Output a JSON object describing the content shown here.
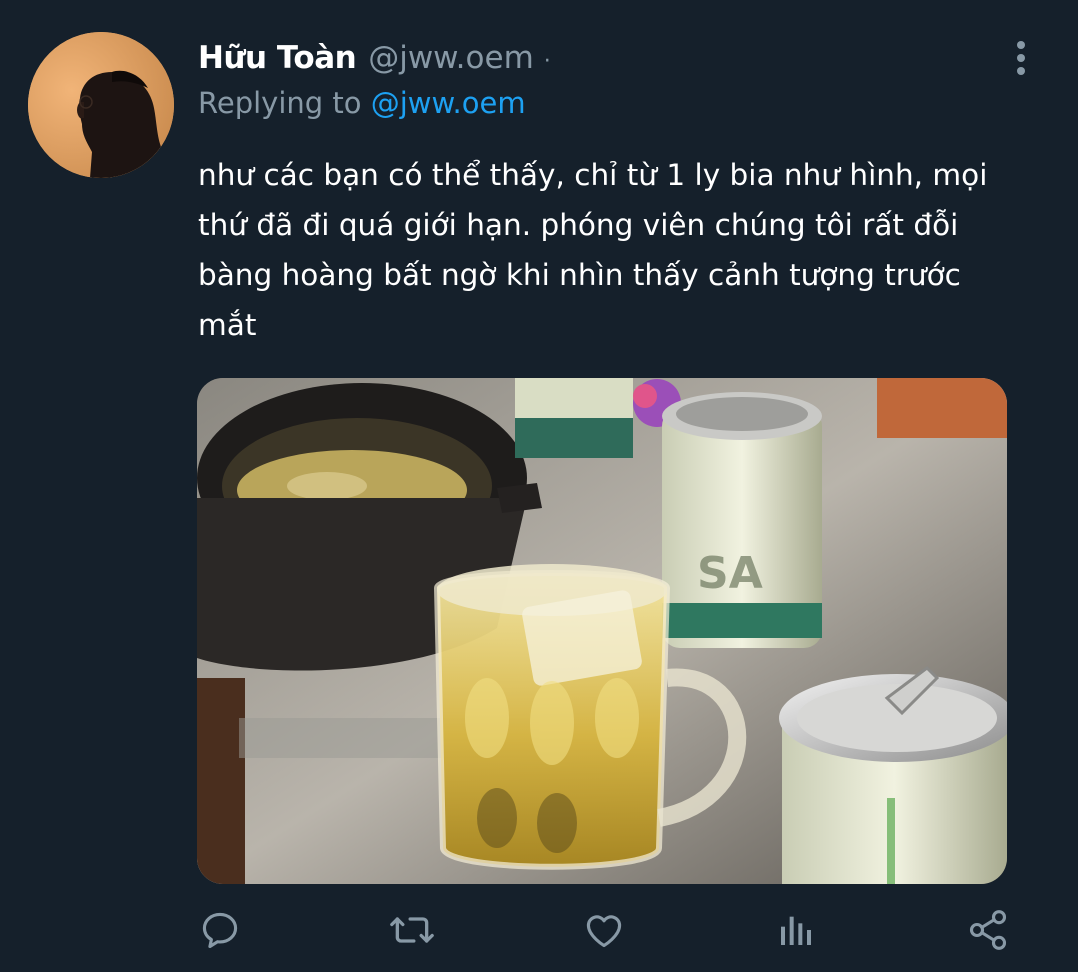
{
  "tweet": {
    "author": {
      "display_name": "Hữu Toàn",
      "handle": "@jww.oem",
      "separator": "·"
    },
    "reply": {
      "prefix": "Replying to ",
      "mention": "@jww.oem"
    },
    "text": "như các bạn có thể thấy, chỉ từ 1 ly bia như hình, mọi thứ đã đi quá giới hạn. phóng viên chúng tôi rất đỗi bàng hoàng bất ngờ khi nhìn thấy cảnh tượng trước mắt",
    "media": {
      "icon": "photo-icon"
    },
    "actions": [
      {
        "name": "reply",
        "icon": "reply-icon"
      },
      {
        "name": "retweet",
        "icon": "retweet-icon"
      },
      {
        "name": "like",
        "icon": "heart-icon"
      },
      {
        "name": "analytics",
        "icon": "analytics-icon"
      },
      {
        "name": "share",
        "icon": "share-icon"
      }
    ]
  },
  "colors": {
    "background": "#15202b",
    "text_primary": "#ffffff",
    "text_secondary": "#8899a6",
    "accent": "#1da1f2"
  }
}
